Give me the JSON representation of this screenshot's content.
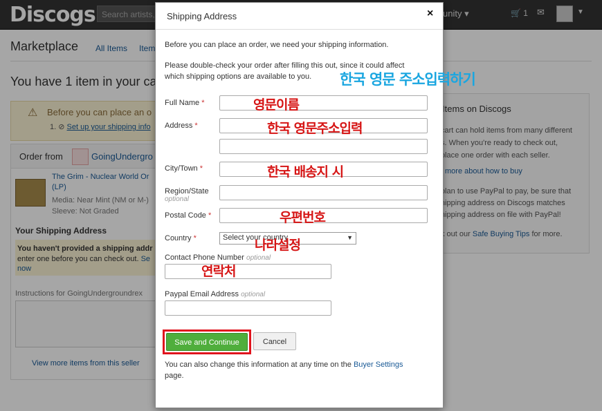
{
  "topbar": {
    "logo": "Discogs",
    "search_placeholder": "Search artists,",
    "community": "unity ▾",
    "cart_count": "1"
  },
  "page": {
    "title": "Marketplace",
    "subnav": [
      "All Items",
      "Items"
    ],
    "you_have": "You have 1 item in your ca",
    "warning": "Before you can place an o",
    "warning_step_prefix": "1.",
    "warning_step_link": "Set up your shipping info",
    "order_from": "Order from",
    "seller": "GoingUndergro",
    "item_title_line1": "The Grim - Nuclear World Or",
    "item_title_line2": "(LP)",
    "item_media": "Media: Near Mint (NM or M-)",
    "item_sleeve": "Sleeve: Not Graded",
    "your_shipping": "Your Shipping Address",
    "ship_warn_line1": "You haven't provided a shipping addr",
    "ship_warn_line2": "enter one before you can check out.",
    "ship_warn_line2_link": "Se",
    "ship_warn_now": "now",
    "instructions_label": "Instructions for GoingUndergroundrex",
    "view_more": "View more items from this seller"
  },
  "right_box": {
    "title": "ng Items on Discogs",
    "p1": [
      "cart can hold items from many different",
      "s. When you're ready to check out,",
      "place one order with each seller."
    ],
    "link": "more about how to buy",
    "p2": [
      "plan to use PayPal to pay, be sure that",
      "hipping address on Discogs matches",
      "hipping address on file with PayPal!"
    ],
    "p3_prefix": "k out our",
    "p3_link": "Safe Buying Tips",
    "p3_suffix": "for more."
  },
  "modal": {
    "title": "Shipping Address",
    "close": "×",
    "intro1": "Before you can place an order, we need your shipping information.",
    "intro2_line1": "Please double-check your order after filling this out, since it could affect",
    "intro2_line2": "which shipping options are available to you.",
    "full_name_label": "Full Name",
    "address_label": "Address",
    "city_label": "City/Town",
    "region_label": "Region/State",
    "optional": "optional",
    "postal_label": "Postal Code",
    "country_label": "Country",
    "country_selected": "Select your country",
    "phone_label": "Contact Phone Number",
    "paypal_label": "Paypal Email Address",
    "required_mark": "*",
    "save_label": "Save and Continue",
    "cancel_label": "Cancel",
    "footnote_prefix": "You can also change this information at any time on the",
    "footnote_link": "Buyer Settings",
    "footnote_suffix": "page."
  },
  "annotations": {
    "header": "한국 영문 주소입력하기",
    "name": "영문이름",
    "address": "한국 영문주소입력",
    "city": "한국 배송지 시",
    "postal": "우편번호",
    "country": "나라설정",
    "phone": "연락처"
  },
  "colors": {
    "annotation_red": "#d61515",
    "annotation_blue": "#1aa6e0",
    "save_green": "#4fae3c",
    "link_blue": "#1a5a96"
  }
}
